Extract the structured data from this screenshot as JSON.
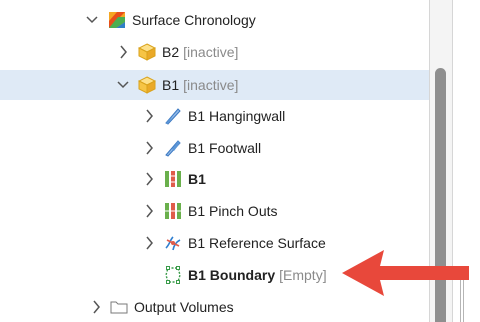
{
  "tree": {
    "items": [
      {
        "label": "Surface Chronology",
        "status": "",
        "icon": "surface-chronology-icon",
        "expanded": true
      },
      {
        "label": "B2",
        "status": "[inactive]",
        "icon": "fault-block-icon",
        "expanded": false
      },
      {
        "label": "B1",
        "status": "[inactive]",
        "icon": "fault-block-icon",
        "expanded": true,
        "selected": true
      },
      {
        "label": "B1 Hangingwall",
        "status": "",
        "icon": "hangingwall-surface-icon",
        "expanded": false
      },
      {
        "label": "B1 Footwall",
        "status": "",
        "icon": "footwall-surface-icon",
        "expanded": false
      },
      {
        "label": "B1",
        "status": "",
        "icon": "contact-surfaces-icon",
        "expanded": false
      },
      {
        "label": "B1 Pinch Outs",
        "status": "",
        "icon": "pinch-outs-icon",
        "expanded": false
      },
      {
        "label": "B1 Reference Surface",
        "status": "",
        "icon": "reference-surface-icon",
        "expanded": false
      },
      {
        "label": "B1 Boundary",
        "status": "[Empty]",
        "icon": "boundary-icon"
      },
      {
        "label": "Output Volumes",
        "status": "",
        "icon": "folder-icon",
        "expanded": false
      }
    ]
  },
  "colors": {
    "selection": "#dfeaf6",
    "arrow": "#e8483b",
    "status_text": "#8a8a8a"
  }
}
